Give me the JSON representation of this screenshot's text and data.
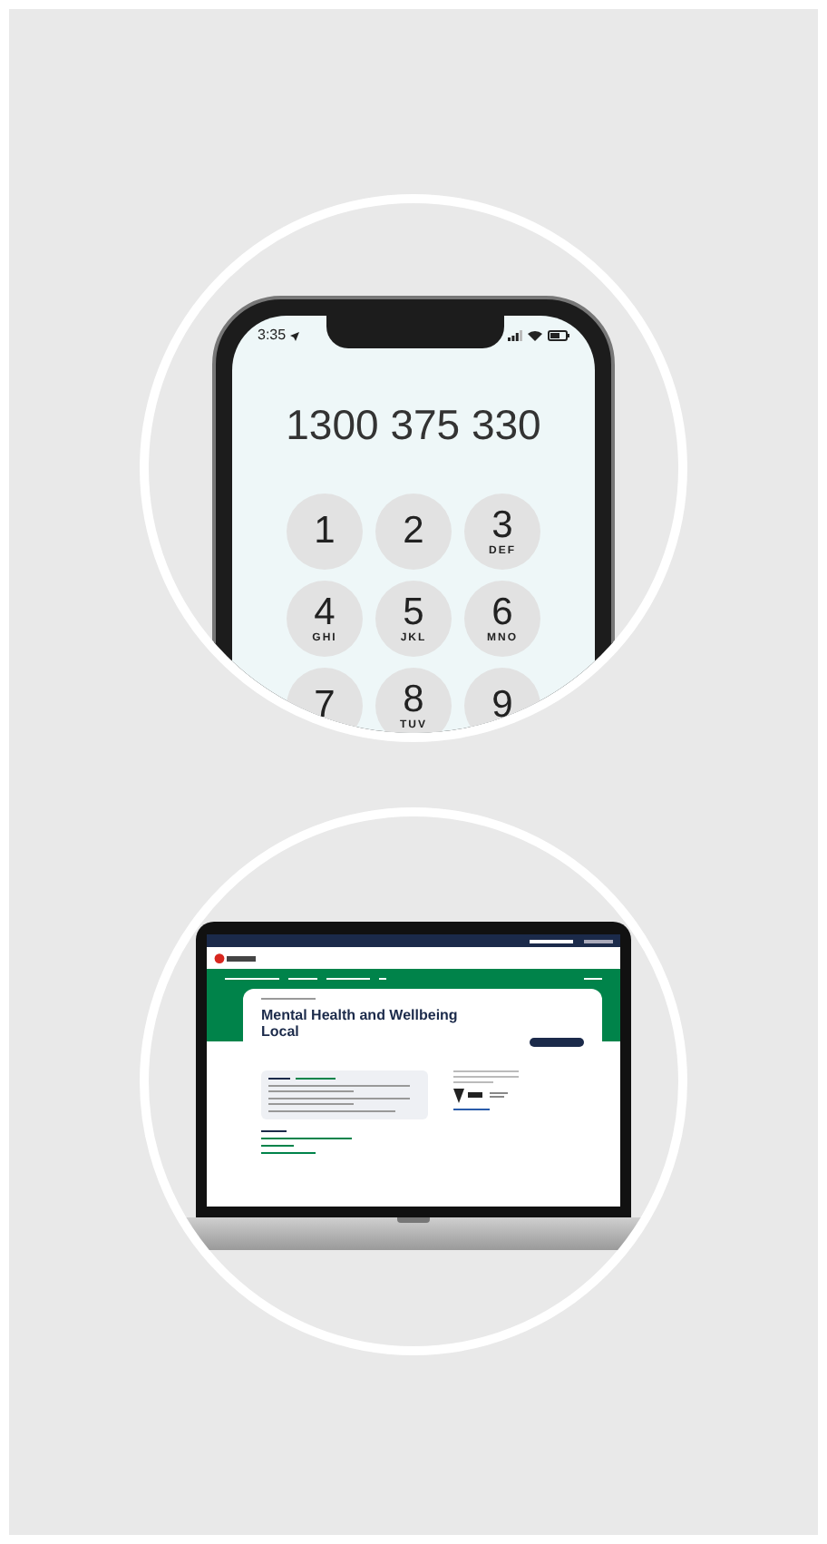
{
  "phone": {
    "status_time": "3:35",
    "dialed_number": "1300 375 330",
    "keys": [
      {
        "digit": "1"
      },
      {
        "digit": "2"
      },
      {
        "digit": "3",
        "letters": "DEF"
      },
      {
        "digit": "4",
        "letters": "GHI"
      },
      {
        "digit": "5",
        "letters": "JKL"
      },
      {
        "digit": "6",
        "letters": "MNO"
      },
      {
        "digit": "7"
      },
      {
        "digit": "8",
        "letters": "TUV"
      },
      {
        "digit": "9"
      }
    ]
  },
  "laptop": {
    "title": "Mental Health and Wellbeing Local"
  }
}
